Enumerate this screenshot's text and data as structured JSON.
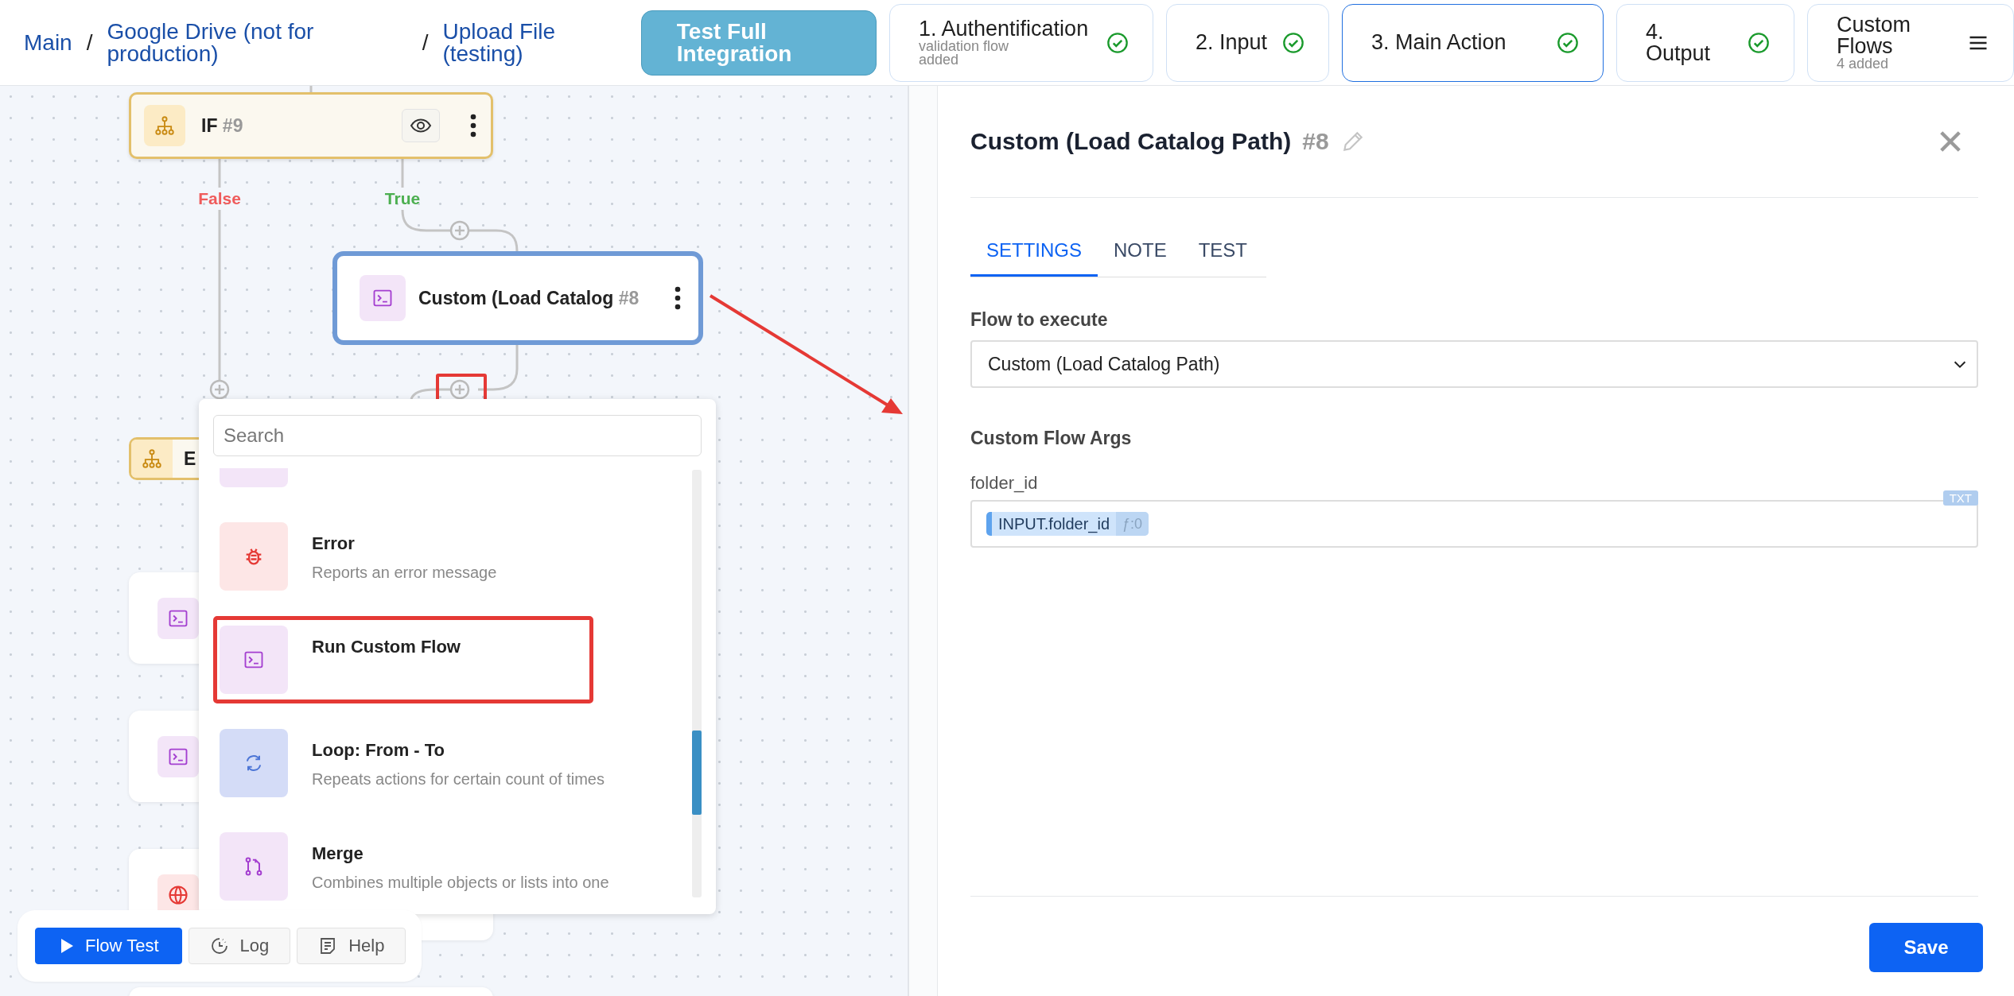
{
  "breadcrumbs": [
    {
      "label": "Main"
    },
    {
      "separator": "/",
      "label": "Google Drive (not for production)"
    },
    {
      "separator": "/",
      "label": "Upload File (testing)"
    }
  ],
  "test_button": "Test Full Integration",
  "steps": [
    {
      "kind": "step",
      "label": "1. Authentification",
      "subtitle": "validation flow added",
      "done": true,
      "selected": false
    },
    {
      "kind": "step",
      "label": "2. Input",
      "done": true,
      "selected": false
    },
    {
      "kind": "step",
      "label": "3. Main Action",
      "done": true,
      "selected": true
    },
    {
      "kind": "step",
      "label": "4. Output",
      "done": true,
      "selected": false
    },
    {
      "kind": "menu",
      "label": "Custom Flows",
      "subtitle": "4 added",
      "selected": false
    }
  ],
  "canvas": {
    "if_node": {
      "title": "IF",
      "number": "#9"
    },
    "branches": [
      {
        "label": "False",
        "color": "#ef5b5b"
      },
      {
        "label": "True",
        "color": "#4caf50"
      }
    ],
    "custom_node": {
      "title": "Custom (Load Catalog",
      "number": "#8",
      "selected": true
    },
    "end_node": {
      "title": "E"
    },
    "add_button_highlighted": true,
    "cards": [
      {
        "kind": "terminal"
      },
      {
        "kind": "terminal"
      },
      {
        "kind": "globe"
      },
      {
        "kind": "blank"
      }
    ],
    "popup": {
      "search": {
        "placeholder": "Search"
      },
      "items": [
        {
          "kind": "terminal",
          "highlighted": false
        },
        {
          "kind": "bug",
          "title": "Error",
          "description": "Reports an error message",
          "highlighted": false
        },
        {
          "kind": "terminal",
          "title": "Run Custom Flow",
          "highlighted": true
        },
        {
          "kind": "loop",
          "title": "Loop: From - To",
          "description": "Repeats actions for certain count of times",
          "highlighted": false
        },
        {
          "kind": "merge",
          "title": "Merge",
          "description": "Combines multiple objects or lists into one",
          "highlighted": false
        }
      ]
    },
    "toolbar": [
      {
        "kind": "primary",
        "label": "Flow Test"
      },
      {
        "kind": "log",
        "label": "Log"
      },
      {
        "kind": "help",
        "label": "Help"
      }
    ]
  },
  "panel": {
    "title": "Custom (Load Catalog Path)",
    "number": "#8",
    "tabs": [
      {
        "label": "SETTINGS",
        "selected": true
      },
      {
        "label": "NOTE",
        "selected": false
      },
      {
        "label": "TEST",
        "selected": false
      }
    ],
    "flow_label": "Flow to execute",
    "flow_value": "Custom (Load Catalog Path)",
    "args_title": "Custom Flow Args",
    "args": [
      {
        "name": "folder_id",
        "chip": "INPUT.folder_id",
        "chip_meta": "ƒ:0",
        "type_badge": "TXT"
      }
    ],
    "save": "Save"
  }
}
